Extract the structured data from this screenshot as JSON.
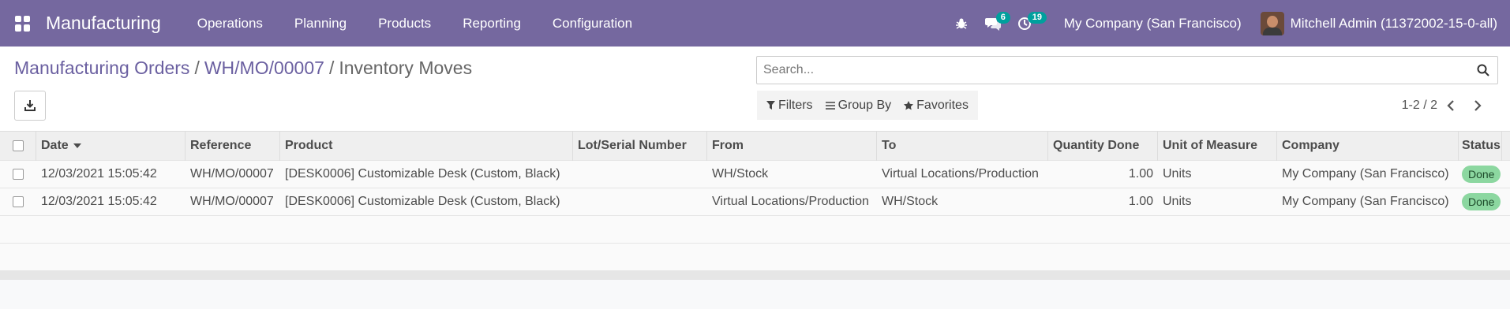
{
  "navbar": {
    "brand": "Manufacturing",
    "menu": [
      "Operations",
      "Planning",
      "Products",
      "Reporting",
      "Configuration"
    ],
    "messages_badge": "6",
    "activities_badge": "19",
    "company": "My Company (San Francisco)",
    "user": "Mitchell Admin (11372002-15-0-all)",
    "color": "#75689f"
  },
  "breadcrumb": {
    "item1": "Manufacturing Orders",
    "item2": "WH/MO/00007",
    "sep": "/",
    "current": "Inventory Moves"
  },
  "search": {
    "placeholder": "Search..."
  },
  "search_options": {
    "filters": "Filters",
    "group_by": "Group By",
    "favorites": "Favorites"
  },
  "pager": {
    "value": "1-2 / 2"
  },
  "table": {
    "headers": {
      "date": "Date",
      "reference": "Reference",
      "product": "Product",
      "lot": "Lot/Serial Number",
      "from": "From",
      "to": "To",
      "qty": "Quantity Done",
      "uom": "Unit of Measure",
      "company": "Company",
      "status": "Status"
    },
    "rows": [
      {
        "date": "12/03/2021 15:05:42",
        "reference": "WH/MO/00007",
        "product": "[DESK0006] Customizable Desk (Custom, Black)",
        "lot": "",
        "from": "WH/Stock",
        "to": "Virtual Locations/Production",
        "qty": "1.00",
        "uom": "Units",
        "company": "My Company (San Francisco)",
        "status": "Done"
      },
      {
        "date": "12/03/2021 15:05:42",
        "reference": "WH/MO/00007",
        "product": "[DESK0006] Customizable Desk (Custom, Black)",
        "lot": "",
        "from": "Virtual Locations/Production",
        "to": "WH/Stock",
        "qty": "1.00",
        "uom": "Units",
        "company": "My Company (San Francisco)",
        "status": "Done"
      }
    ]
  }
}
